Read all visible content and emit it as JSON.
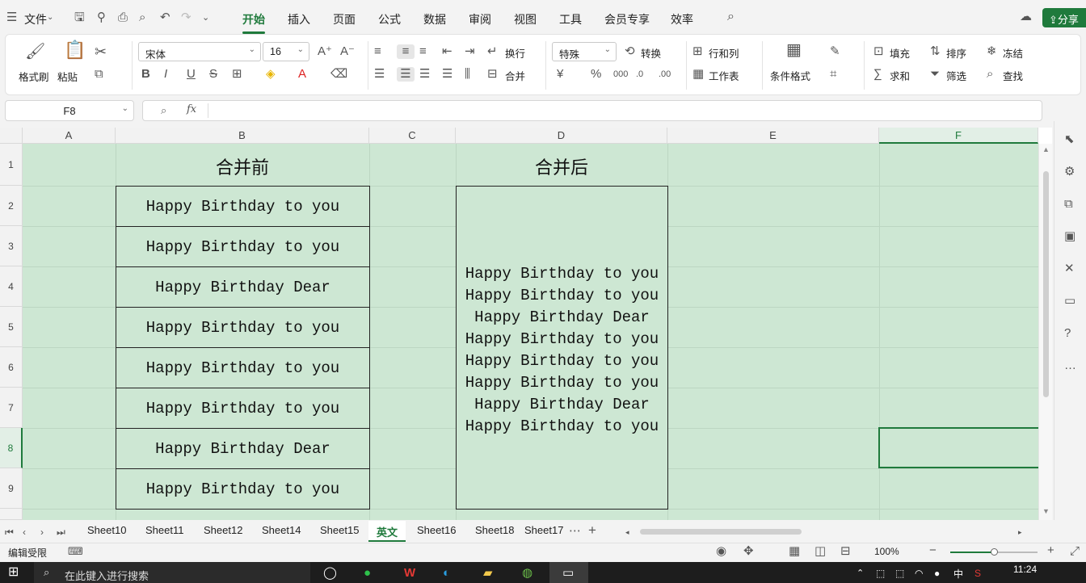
{
  "menu": {
    "file": "文件",
    "tabs": [
      "开始",
      "插入",
      "页面",
      "公式",
      "数据",
      "审阅",
      "视图",
      "工具",
      "会员专享",
      "效率"
    ],
    "active": 0,
    "share": "分享"
  },
  "ribbon": {
    "format_painter": "格式刷",
    "paste": "粘贴",
    "font": "宋体",
    "size": "16",
    "wrap": "换行",
    "merge": "合并",
    "number_format": "特殊",
    "convert": "转换",
    "rowcol": "行和列",
    "sheet": "工作表",
    "cond_format": "条件格式",
    "fill": "填充",
    "sort": "排序",
    "freeze": "冻结",
    "sum": "求和",
    "filter": "筛选",
    "find": "查找"
  },
  "formula": {
    "cell": "F8",
    "fx": "fx",
    "value": ""
  },
  "columns": [
    "A",
    "B",
    "C",
    "D",
    "E",
    "F"
  ],
  "rows": [
    "1",
    "2",
    "3",
    "4",
    "5",
    "6",
    "7",
    "8",
    "9"
  ],
  "sheet": {
    "b1": "合并前",
    "d1": "合并后",
    "before": [
      "Happy Birthday to you",
      "Happy Birthday to you",
      "Happy Birthday Dear",
      "Happy Birthday to you",
      "Happy Birthday to you",
      "Happy Birthday to you",
      "Happy Birthday Dear",
      "Happy Birthday to you"
    ],
    "after": [
      "Happy Birthday to you",
      "Happy Birthday to you",
      "Happy Birthday Dear",
      "Happy Birthday to you",
      "Happy Birthday to you",
      "Happy Birthday to you",
      "Happy Birthday Dear",
      "Happy Birthday to you"
    ]
  },
  "sheet_tabs": [
    "Sheet10",
    "Sheet11",
    "Sheet12",
    "Sheet14",
    "Sheet15",
    "英文",
    "Sheet16",
    "Sheet18",
    "Sheet17"
  ],
  "active_tab": "英文",
  "status": {
    "mode": "编辑受限",
    "zoom": "100%"
  },
  "taskbar": {
    "search": "在此键入进行搜索",
    "time": "11:24",
    "ime": "中"
  },
  "colors": {
    "accent": "#1f7a3c",
    "cell_bg": "#cde7d3"
  }
}
